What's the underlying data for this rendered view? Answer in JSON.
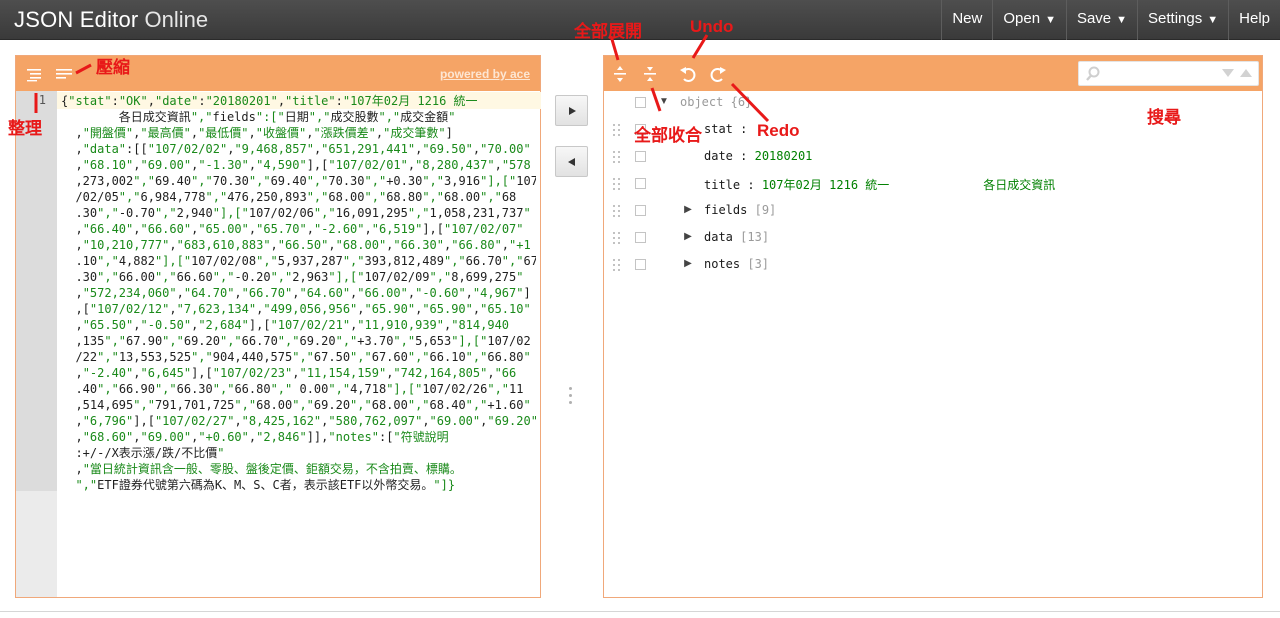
{
  "header": {
    "title_main": "JSON Editor",
    "title_sub": "Online",
    "menu": [
      {
        "label": "New",
        "caret": ""
      },
      {
        "label": "Open",
        "caret": "▼"
      },
      {
        "label": "Save",
        "caret": "▼"
      },
      {
        "label": "Settings",
        "caret": "▼"
      },
      {
        "label": "Help",
        "caret": ""
      }
    ]
  },
  "code_panel": {
    "powered_by": "powered by ace",
    "line_number": "1",
    "lines": [
      "{\"stat\":\"OK\",\"date\":\"20180201\",\"title\":\"107年02月 1216 統一",
      "        各日成交資訊\",\"fields\":[\"日期\",\"成交股數\",\"成交金額\"",
      "  ,\"開盤價\",\"最高價\",\"最低價\",\"收盤價\",\"漲跌價差\",\"成交筆數\"]",
      "  ,\"data\":[[\"107/02/02\",\"9,468,857\",\"651,291,441\",\"69.50\",\"70.00\"",
      "  ,\"68.10\",\"69.00\",\"-1.30\",\"4,590\"],[\"107/02/01\",\"8,280,437\",\"578",
      "  ,273,002\",\"69.40\",\"70.30\",\"69.40\",\"70.30\",\"+0.30\",\"3,916\"],[\"107",
      "  /02/05\",\"6,984,778\",\"476,250,893\",\"68.00\",\"68.80\",\"68.00\",\"68",
      "  .30\",\"-0.70\",\"2,940\"],[\"107/02/06\",\"16,091,295\",\"1,058,231,737\"",
      "  ,\"66.40\",\"66.60\",\"65.00\",\"65.70\",\"-2.60\",\"6,519\"],[\"107/02/07\"",
      "  ,\"10,210,777\",\"683,610,883\",\"66.50\",\"68.00\",\"66.30\",\"66.80\",\"+1",
      "  .10\",\"4,882\"],[\"107/02/08\",\"5,937,287\",\"393,812,489\",\"66.70\",\"67",
      "  .30\",\"66.00\",\"66.60\",\"-0.20\",\"2,963\"],[\"107/02/09\",\"8,699,275\"",
      "  ,\"572,234,060\",\"64.70\",\"66.70\",\"64.60\",\"66.00\",\"-0.60\",\"4,967\"]",
      "  ,[\"107/02/12\",\"7,623,134\",\"499,056,956\",\"65.90\",\"65.90\",\"65.10\"",
      "  ,\"65.50\",\"-0.50\",\"2,684\"],[\"107/02/21\",\"11,910,939\",\"814,940",
      "  ,135\",\"67.90\",\"69.20\",\"66.70\",\"69.20\",\"+3.70\",\"5,653\"],[\"107/02",
      "  /22\",\"13,553,525\",\"904,440,575\",\"67.50\",\"67.60\",\"66.10\",\"66.80\"",
      "  ,\"-2.40\",\"6,645\"],[\"107/02/23\",\"11,154,159\",\"742,164,805\",\"66",
      "  .40\",\"66.90\",\"66.30\",\"66.80\",\" 0.00\",\"4,718\"],[\"107/02/26\",\"11",
      "  ,514,695\",\"791,701,725\",\"68.00\",\"69.20\",\"68.00\",\"68.40\",\"+1.60\"",
      "  ,\"6,796\"],[\"107/02/27\",\"8,425,162\",\"580,762,097\",\"69.00\",\"69.20\"",
      "  ,\"68.60\",\"69.00\",\"+0.60\",\"2,846\"]],\"notes\":[\"符號說明",
      "  :+/-/X表示漲/跌/不比價\"",
      "  ,\"當日統計資訊含一般、零股、盤後定價、鉅額交易，不含拍賣、標購。",
      "  \",\"ETF證券代號第六碼為K、M、S、C者，表示該ETF以外幣交易。\"]}"
    ]
  },
  "tree_panel": {
    "search_placeholder": "",
    "rows": [
      {
        "key": "object",
        "count": "{6}",
        "value": "",
        "type": "root"
      },
      {
        "key": "stat",
        "sep": " : ",
        "value": "",
        "type": "string"
      },
      {
        "key": "date",
        "sep": " : ",
        "value": "20180201",
        "type": "string"
      },
      {
        "key": "title",
        "sep": " : ",
        "value": "107年02月 1216 統一             各日成交資訊",
        "type": "string"
      },
      {
        "key": "fields",
        "count": "[9]",
        "type": "array"
      },
      {
        "key": "data",
        "count": "[13]",
        "type": "array"
      },
      {
        "key": "notes",
        "count": "[3]",
        "type": "array"
      }
    ]
  },
  "annotations": {
    "compact": "壓縮",
    "format": "整理",
    "expand_all": "全部展開",
    "collapse_all": "全部收合",
    "undo": "Undo",
    "redo": "Redo",
    "search": "搜尋"
  },
  "colors": {
    "panel_bar": "#f5a466",
    "header_bg": "#3f3f3f",
    "annotation": "#e81919"
  }
}
